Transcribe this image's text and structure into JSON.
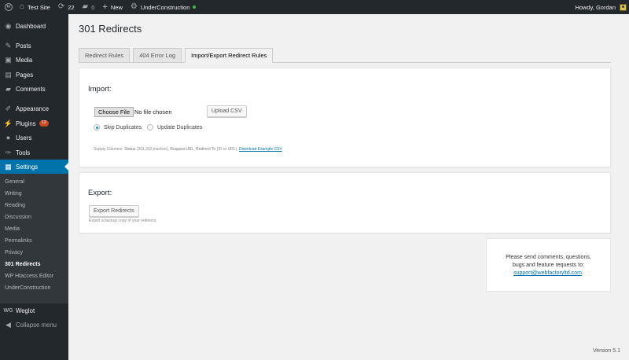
{
  "adminbar": {
    "site_name": "Test Site",
    "updates_count": "22",
    "comments_count": "0",
    "new_label": "New",
    "plugin_label": "UnderConstruction",
    "howdy": "Howdy, Gordan"
  },
  "sidebar": {
    "dashboard": "Dashboard",
    "posts": "Posts",
    "media": "Media",
    "pages": "Pages",
    "comments": "Comments",
    "appearance": "Appearance",
    "plugins": "Plugins",
    "plugins_badge": "13",
    "users": "Users",
    "tools": "Tools",
    "settings": "Settings",
    "weglot": "Weglot",
    "collapse": "Collapse menu",
    "submenu": [
      "General",
      "Writing",
      "Reading",
      "Discussion",
      "Media",
      "Permalinks",
      "Privacy",
      "301 Redirects",
      "WP Htaccess Editor",
      "UnderConstruction"
    ]
  },
  "page": {
    "title": "301 Redirects",
    "tabs": [
      "Redirect Rules",
      "404 Error Log",
      "Import/Export Redirect Rules"
    ]
  },
  "import": {
    "heading": "Import:",
    "choose_file": "Choose File",
    "file_status": "No file chosen",
    "upload_button": "Upload CSV",
    "skip_label": "Skip Duplicates",
    "update_label": "Update Duplicates",
    "note_prefix": "Supply Columns: ",
    "note_status": "Status",
    "note_status_detail": " (301,302,inactive), ",
    "note_request": "Request URL",
    "note_sep": ", ",
    "note_redirect": "Redirect To",
    "note_redirect_detail": " (ID or URL). ",
    "download_link": "Download Example CSV"
  },
  "export": {
    "heading": "Export:",
    "button": "Export Redirects",
    "note": "Export a backup copy of your redirects."
  },
  "support": {
    "text": "Please send comments, questions, bugs and feature requests to:",
    "email": "support@webfactoryltd.com",
    "suffix": "."
  },
  "footer": {
    "version": "Version 5.1"
  }
}
